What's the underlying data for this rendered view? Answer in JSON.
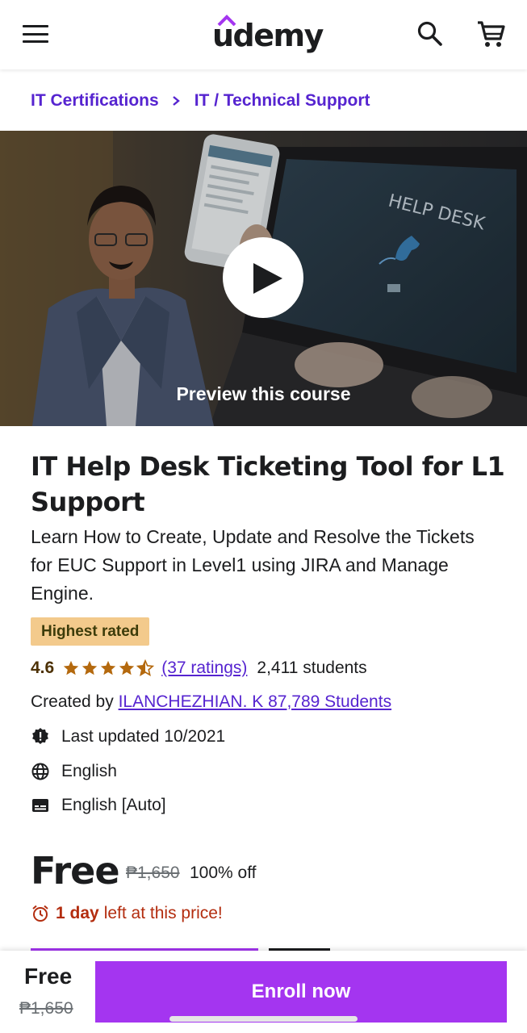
{
  "header": {
    "logo_text": "udemy",
    "menu_icon": "hamburger-menu-icon",
    "search_icon": "search-icon",
    "cart_icon": "cart-icon"
  },
  "breadcrumb": {
    "items": [
      "IT Certifications",
      "IT / Technical Support"
    ]
  },
  "preview": {
    "label": "Preview this course",
    "screen_text": "HELP DESK"
  },
  "course": {
    "title": "IT Help Desk Ticketing Tool for L1 Support",
    "subtitle": "Learn How to Create, Update and Resolve the Tickets for EUC Support in Level1 using JIRA and Manage Engine.",
    "badge": "Highest rated",
    "rating": "4.6",
    "rating_stars": 4.6,
    "ratings_count": "(37 ratings)",
    "students": "2,411 students",
    "created_by_label": "Created by",
    "instructor": "ILANCHEZHIAN. K 87,789 Students",
    "last_updated": "Last updated 10/2021",
    "language": "English",
    "captions": "English [Auto]"
  },
  "pricing": {
    "price": "Free",
    "original_price": "₱1,650",
    "discount": "100% off",
    "deadline_bold": "1 day",
    "deadline_rest": "left at this price!"
  },
  "footer": {
    "price": "Free",
    "original_price": "₱1,650",
    "enroll_label": "Enroll now"
  },
  "colors": {
    "brand_purple": "#5624d0",
    "enroll_purple": "#a435f0",
    "badge_bg": "#f3ca8c",
    "star_color": "#b4690e",
    "deadline_red": "#b32d0f"
  }
}
